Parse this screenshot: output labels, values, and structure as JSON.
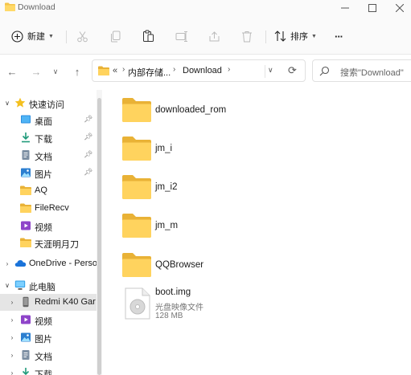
{
  "window": {
    "title": "Download"
  },
  "toolbar": {
    "new_label": "新建",
    "sort_label": "排序",
    "more_label": "···"
  },
  "address": {
    "overflow": "«",
    "crumbs": [
      "内部存储...",
      "Download"
    ]
  },
  "search": {
    "placeholder": "搜索\"Download\""
  },
  "sidebar": {
    "items": [
      {
        "label": "快速访问",
        "icon": "star-icon"
      },
      {
        "label": "桌面",
        "icon": "desktop-icon",
        "pinned": true
      },
      {
        "label": "下载",
        "icon": "download-icon",
        "pinned": true
      },
      {
        "label": "文档",
        "icon": "document-icon",
        "pinned": true
      },
      {
        "label": "图片",
        "icon": "picture-icon",
        "pinned": true
      },
      {
        "label": "AQ",
        "icon": "folder-icon"
      },
      {
        "label": "FileRecv",
        "icon": "folder-icon"
      },
      {
        "label": "视频",
        "icon": "video-icon"
      },
      {
        "label": "天涯明月刀",
        "icon": "folder-icon"
      },
      {
        "label": "OneDrive - Perso",
        "icon": "cloud-icon"
      },
      {
        "label": "此电脑",
        "icon": "pc-icon"
      },
      {
        "label": "Redmi K40 Gar",
        "icon": "phone-icon"
      },
      {
        "label": "视频",
        "icon": "video-icon"
      },
      {
        "label": "图片",
        "icon": "picture-icon"
      },
      {
        "label": "文档",
        "icon": "document-icon"
      },
      {
        "label": "下载",
        "icon": "download-icon"
      }
    ]
  },
  "files": [
    {
      "name": "downloaded_rom",
      "type": "folder"
    },
    {
      "name": "jm_i",
      "type": "folder"
    },
    {
      "name": "jm_i2",
      "type": "folder"
    },
    {
      "name": "jm_m",
      "type": "folder"
    },
    {
      "name": "QQBrowser",
      "type": "folder"
    },
    {
      "name": "boot.img",
      "type": "disc-image",
      "kind": "光盘映像文件",
      "size": "128 MB"
    }
  ],
  "colors": {
    "folder": "#f5c54a",
    "folder_tab": "#e9b236",
    "accent": "#0067c0"
  }
}
